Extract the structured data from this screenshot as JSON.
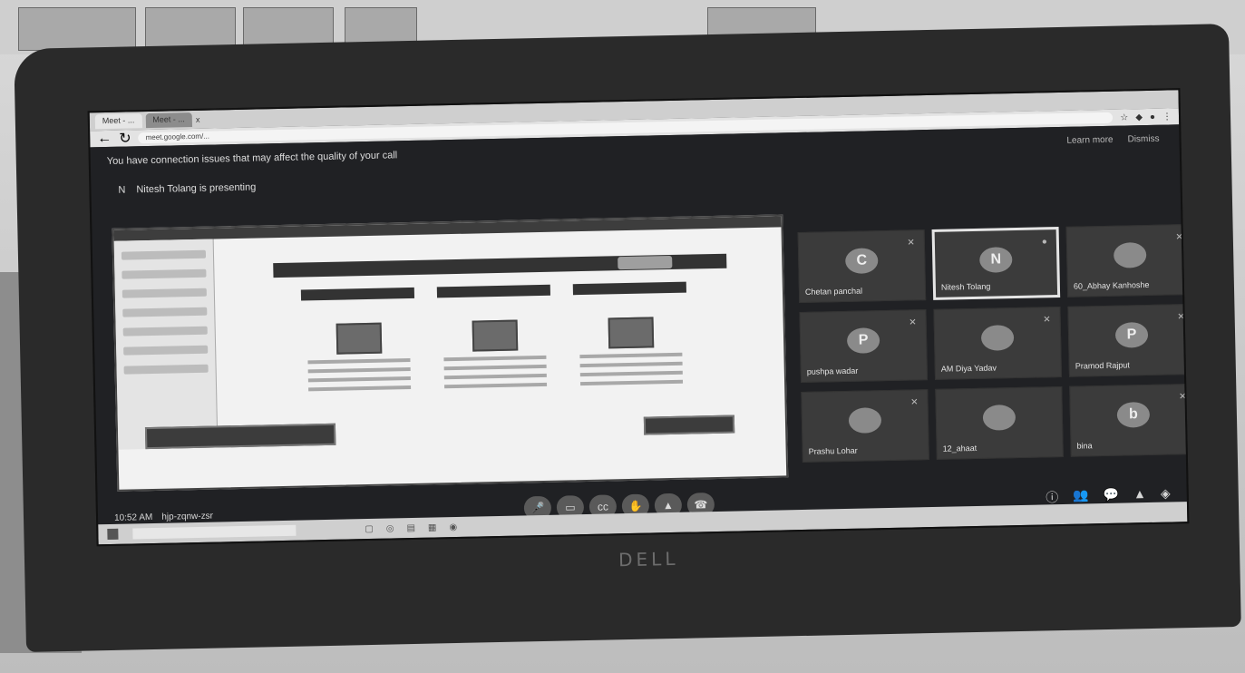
{
  "brand": {
    "label": "DELL"
  },
  "browser": {
    "tabs": [
      {
        "label": "Meet - ..."
      },
      {
        "label": "Meet - ..."
      },
      {
        "label": "x"
      }
    ],
    "url": "meet.google.com/..."
  },
  "meet": {
    "warning": "You have connection issues that may affect the quality of your call",
    "warning_actions": [
      "Learn more",
      "Dismiss"
    ],
    "presenter": {
      "initial": "N",
      "text": "Nitesh Tolang is presenting"
    },
    "participants": [
      {
        "initial": "C",
        "name": "Chetan panchal",
        "active": false
      },
      {
        "initial": "N",
        "name": "Nitesh Tolang",
        "active": true
      },
      {
        "initial": "",
        "name": "60_Abhay Kanhoshe",
        "active": false
      },
      {
        "initial": "P",
        "name": "pushpa wadar",
        "active": false
      },
      {
        "initial": "",
        "name": "AM Diya Yadav",
        "active": false
      },
      {
        "initial": "P",
        "name": "Pramod Rajput",
        "active": false
      },
      {
        "initial": "",
        "name": "Prashu Lohar",
        "active": false
      },
      {
        "initial": "",
        "name": "12_ahaat",
        "active": false
      },
      {
        "initial": "b",
        "name": "bina",
        "active": false
      }
    ],
    "footer_time": "10:52 AM",
    "footer_meeting": "hjp-zqnw-zsr",
    "controls": [
      "mic",
      "cam",
      "cc",
      "raise",
      "present",
      "end"
    ],
    "side_controls": [
      "info",
      "people",
      "chat",
      "activities",
      "shield"
    ]
  },
  "colors": {
    "meet_bg": "#202124",
    "tile_bg": "#3b3b3b"
  }
}
